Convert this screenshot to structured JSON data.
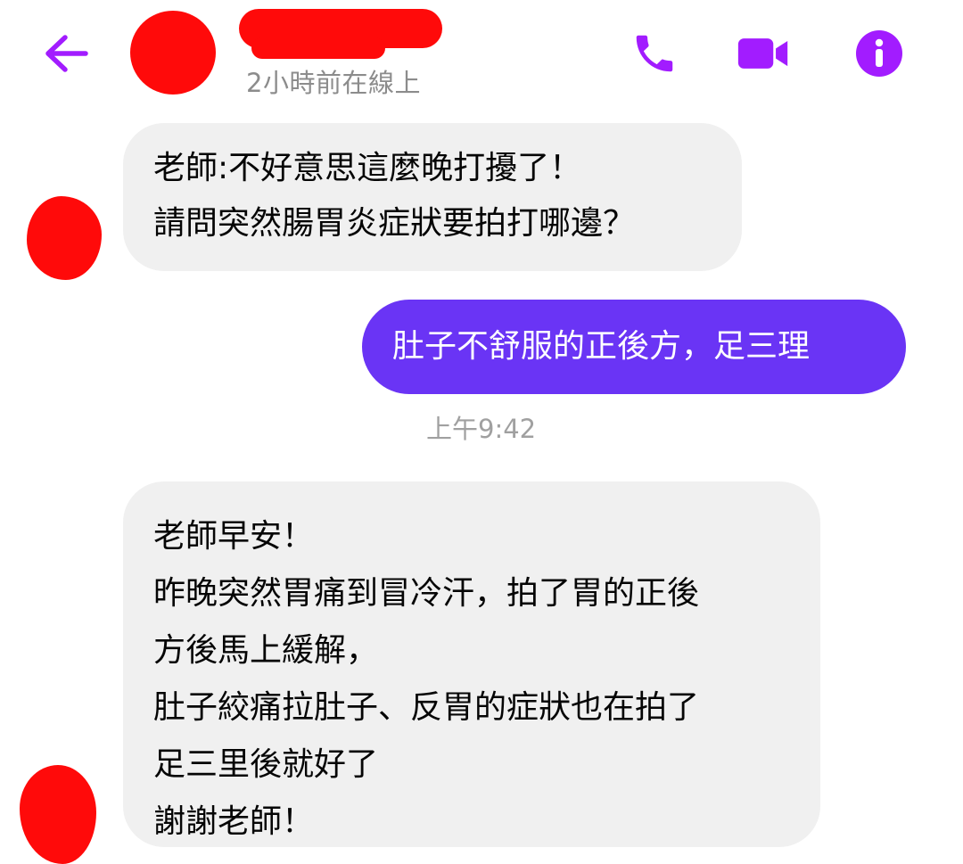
{
  "header": {
    "status": "2小時前在線上",
    "icons": {
      "back": "back-arrow-icon",
      "call": "phone-icon",
      "video": "video-camera-icon",
      "info": "info-icon"
    },
    "accent_color": "#a21cff"
  },
  "messages": [
    {
      "direction": "incoming",
      "text": "老師:不好意思這麼晚打擾了！\n請問突然腸胃炎症狀要拍打哪邊？"
    },
    {
      "direction": "outgoing",
      "text": "肚子不舒服的正後方，足三理",
      "bubble_color": "#6a34f5"
    },
    {
      "timestamp": "上午9:42"
    },
    {
      "direction": "incoming",
      "text": "老師早安！\n昨晚突然胃痛到冒冷汗，拍了胃的正後\n方後馬上緩解，\n肚子絞痛拉肚子、反胃的症狀也在拍了\n足三里後就好了\n謝謝老師！"
    }
  ]
}
